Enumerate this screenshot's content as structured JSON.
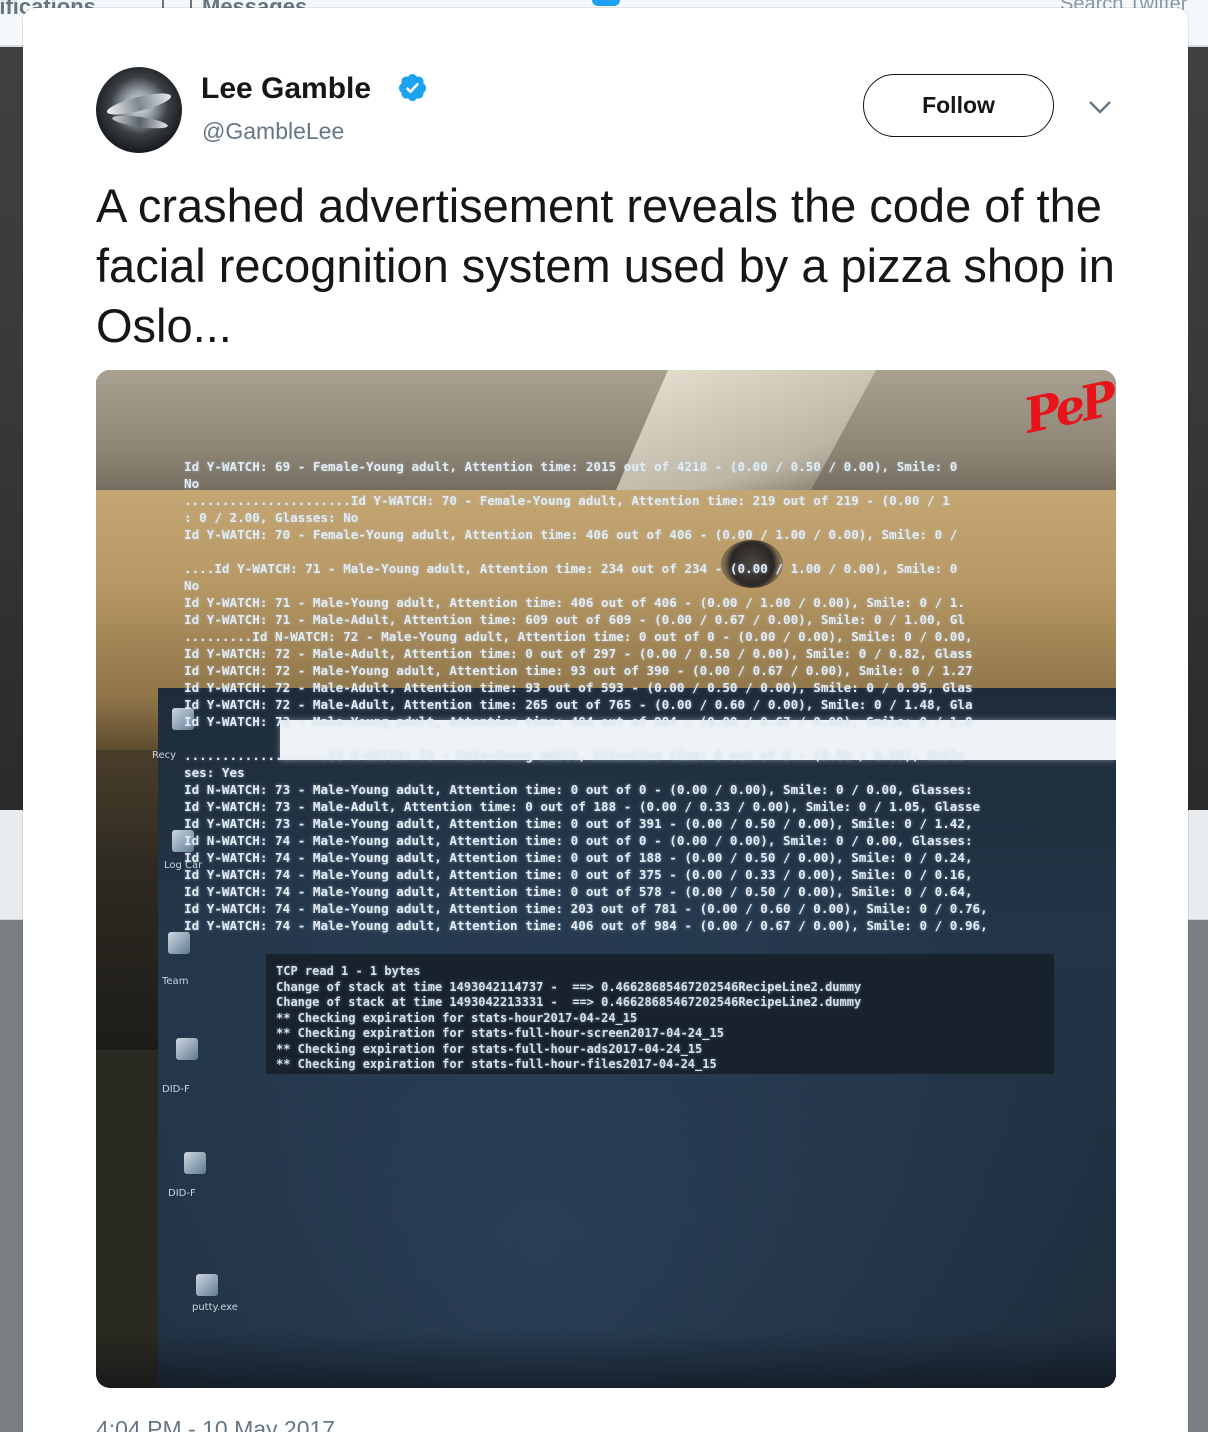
{
  "background_nav": {
    "notifications": "tifications",
    "messages": "Messages",
    "search": "Search Twitter"
  },
  "tweet": {
    "author_name": "Lee Gamble",
    "handle": "@GambleLee",
    "verified": true,
    "follow_label": "Follow",
    "text": "A crashed advertisement reveals the code of the facial recognition system used by a pizza shop in Oslo...",
    "timestamp": "4:04 PM - 10 May 2017"
  },
  "icons": {
    "verified": "verified-badge-icon",
    "more": "chevron-down-icon",
    "messages": "mail-icon"
  },
  "colors": {
    "verified_blue": "#1da1f2",
    "text": "#14171a",
    "secondary": "#657786"
  },
  "photo": {
    "sign_text": "PeP",
    "desktop_labels": [
      "Recy",
      "Log Car",
      "Team",
      "DID-F",
      "DID-F",
      "putty.exe"
    ],
    "log_lines": [
      "Id Y-WATCH: 69 - Female-Young adult, Attention time: 2015 out of 4218 - (0.00 / 0.50 / 0.00), Smile: 0",
      "No",
      "......................Id Y-WATCH: 70 - Female-Young adult, Attention time: 219 out of 219 - (0.00 / 1",
      ": 0 / 2.00, Glasses: No",
      "Id Y-WATCH: 70 - Female-Young adult, Attention time: 406 out of 406 - (0.00 / 1.00 / 0.00), Smile: 0 /",
      "",
      "....Id Y-WATCH: 71 - Male-Young adult, Attention time: 234 out of 234 - (0.00 / 1.00 / 0.00), Smile: 0",
      "No",
      "Id Y-WATCH: 71 - Male-Young adult, Attention time: 406 out of 406 - (0.00 / 1.00 / 0.00), Smile: 0 / 1.",
      "Id Y-WATCH: 71 - Male-Adult, Attention time: 609 out of 609 - (0.00 / 0.67 / 0.00), Smile: 0 / 1.00, Gl",
      ".........Id N-WATCH: 72 - Male-Young adult, Attention time: 0 out of 0 - (0.00 / 0.00), Smile: 0 / 0.00,",
      "Id Y-WATCH: 72 - Male-Adult, Attention time: 0 out of 297 - (0.00 / 0.50 / 0.00), Smile: 0 / 0.82, Glass",
      "Id Y-WATCH: 72 - Male-Young adult, Attention time: 93 out of 390 - (0.00 / 0.67 / 0.00), Smile: 0 / 1.27",
      "Id Y-WATCH: 72 - Male-Adult, Attention time: 93 out of 593 - (0.00 / 0.50 / 0.00), Smile: 0 / 0.95, Glas",
      "Id Y-WATCH: 72 - Male-Adult, Attention time: 265 out of 765 - (0.00 / 0.60 / 0.00), Smile: 0 / 1.48, Gla",
      "Id Y-WATCH: 72 - Male-Young adult, Attention time: 484 out of 984 - (0.00 / 0.67 / 0.00), Smile: 0 / 1.8",
      "",
      "...................Id N-WATCH: 73 - Male-Young adult, Attention time: 0 out of 0 - (0.00 / 0.00), Smile",
      "ses: Yes",
      "Id N-WATCH: 73 - Male-Young adult, Attention time: 0 out of 0 - (0.00 / 0.00), Smile: 0 / 0.00, Glasses:",
      "Id Y-WATCH: 73 - Male-Adult, Attention time: 0 out of 188 - (0.00 / 0.33 / 0.00), Smile: 0 / 1.05, Glasse",
      "Id Y-WATCH: 73 - Male-Young adult, Attention time: 0 out of 391 - (0.00 / 0.50 / 0.00), Smile: 0 / 1.42,",
      "Id N-WATCH: 74 - Male-Young adult, Attention time: 0 out of 0 - (0.00 / 0.00), Smile: 0 / 0.00, Glasses:",
      "Id Y-WATCH: 74 - Male-Young adult, Attention time: 0 out of 188 - (0.00 / 0.50 / 0.00), Smile: 0 / 0.24,",
      "Id Y-WATCH: 74 - Male-Young adult, Attention time: 0 out of 375 - (0.00 / 0.33 / 0.00), Smile: 0 / 0.16,",
      "Id Y-WATCH: 74 - Male-Young adult, Attention time: 0 out of 578 - (0.00 / 0.50 / 0.00), Smile: 0 / 0.64,",
      "Id Y-WATCH: 74 - Male-Young adult, Attention time: 203 out of 781 - (0.00 / 0.60 / 0.00), Smile: 0 / 0.76,",
      "Id Y-WATCH: 74 - Male-Young adult, Attention time: 406 out of 984 - (0.00 / 0.67 / 0.00), Smile: 0 / 0.96,"
    ],
    "console_lines": [
      "TCP read 1 - 1 bytes",
      "Change of stack at time 1493042114737 -  ==> 0.46628685467202546RecipeLine2.dummy",
      "Change of stack at time 1493042213331 -  ==> 0.46628685467202546RecipeLine2.dummy",
      "** Checking expiration for stats-hour2017-04-24_15",
      "** Checking expiration for stats-full-hour-screen2017-04-24_15",
      "** Checking expiration for stats-full-hour-ads2017-04-24_15",
      "** Checking expiration for stats-full-hour-files2017-04-24_15"
    ]
  }
}
